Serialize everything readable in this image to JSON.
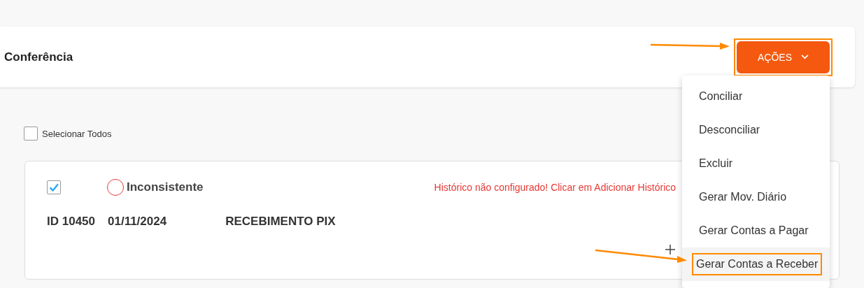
{
  "header": {
    "title": "Conferência",
    "actions_button": {
      "label": "AÇÕES",
      "highlighted": true
    }
  },
  "select_all": {
    "label": "Selecionar Todos",
    "checked": false
  },
  "entries": [
    {
      "checked": true,
      "status": "Inconsistente",
      "warning": "Histórico não configurado! Clicar em Adicionar Histórico",
      "id": "ID 10450",
      "date": "01/11/2024",
      "description": "RECEBIMENTO PIX"
    }
  ],
  "actions_menu": {
    "items": [
      {
        "label": "Conciliar",
        "selected": false,
        "highlighted": false
      },
      {
        "label": "Desconciliar",
        "selected": false,
        "highlighted": false
      },
      {
        "label": "Excluir",
        "selected": false,
        "highlighted": false
      },
      {
        "label": "Gerar Mov. Diário",
        "selected": false,
        "highlighted": false
      },
      {
        "label": "Gerar Contas a Pagar",
        "selected": false,
        "highlighted": false
      },
      {
        "label": "Gerar Contas a Receber",
        "selected": true,
        "highlighted": true
      }
    ]
  }
}
